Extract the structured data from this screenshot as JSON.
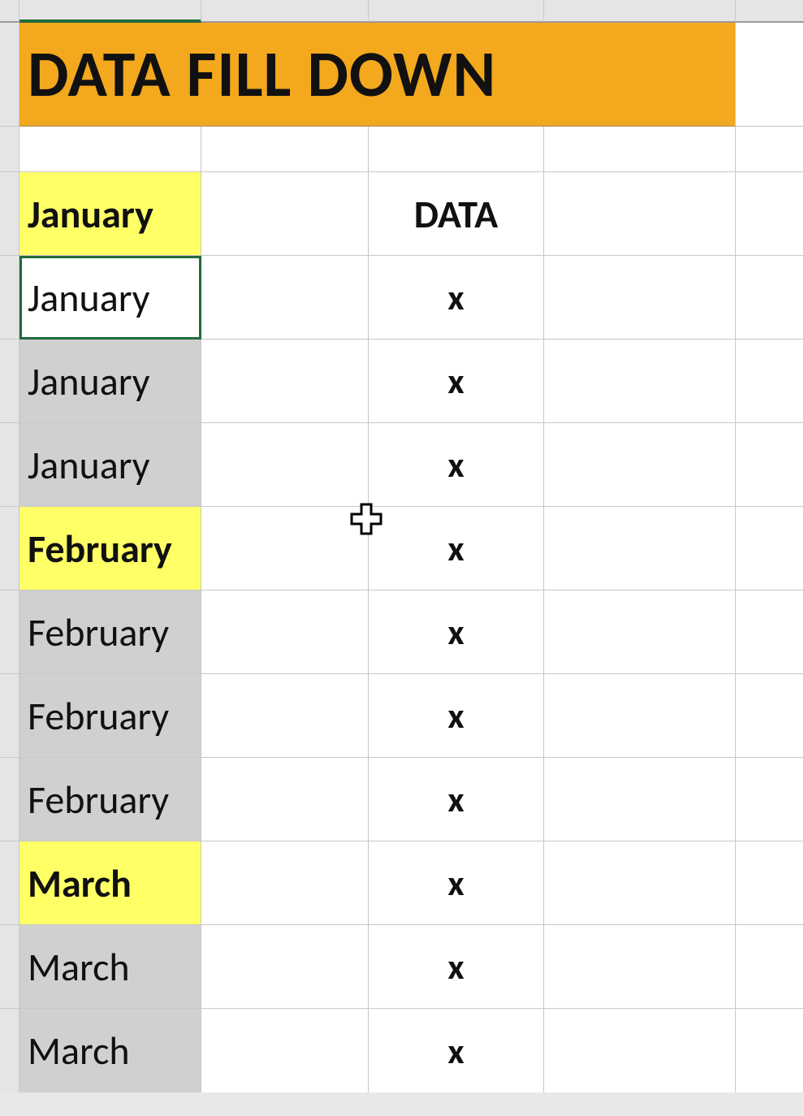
{
  "title": "DATA FILL DOWN",
  "headers": {
    "data": "DATA"
  },
  "rows": [
    {
      "month": "January",
      "header": true,
      "data": ""
    },
    {
      "month": "January",
      "header": false,
      "data": "x"
    },
    {
      "month": "January",
      "header": false,
      "data": "x"
    },
    {
      "month": "January",
      "header": false,
      "data": "x"
    },
    {
      "month": "February",
      "header": true,
      "data": "x"
    },
    {
      "month": "February",
      "header": false,
      "data": "x"
    },
    {
      "month": "February",
      "header": false,
      "data": "x"
    },
    {
      "month": "February",
      "header": false,
      "data": "x"
    },
    {
      "month": "March",
      "header": true,
      "data": "x"
    },
    {
      "month": "March",
      "header": false,
      "data": "x"
    },
    {
      "month": "March",
      "header": false,
      "data": "x"
    }
  ],
  "active_cell_index": 1,
  "cursor_icon": "plus-select-icon"
}
